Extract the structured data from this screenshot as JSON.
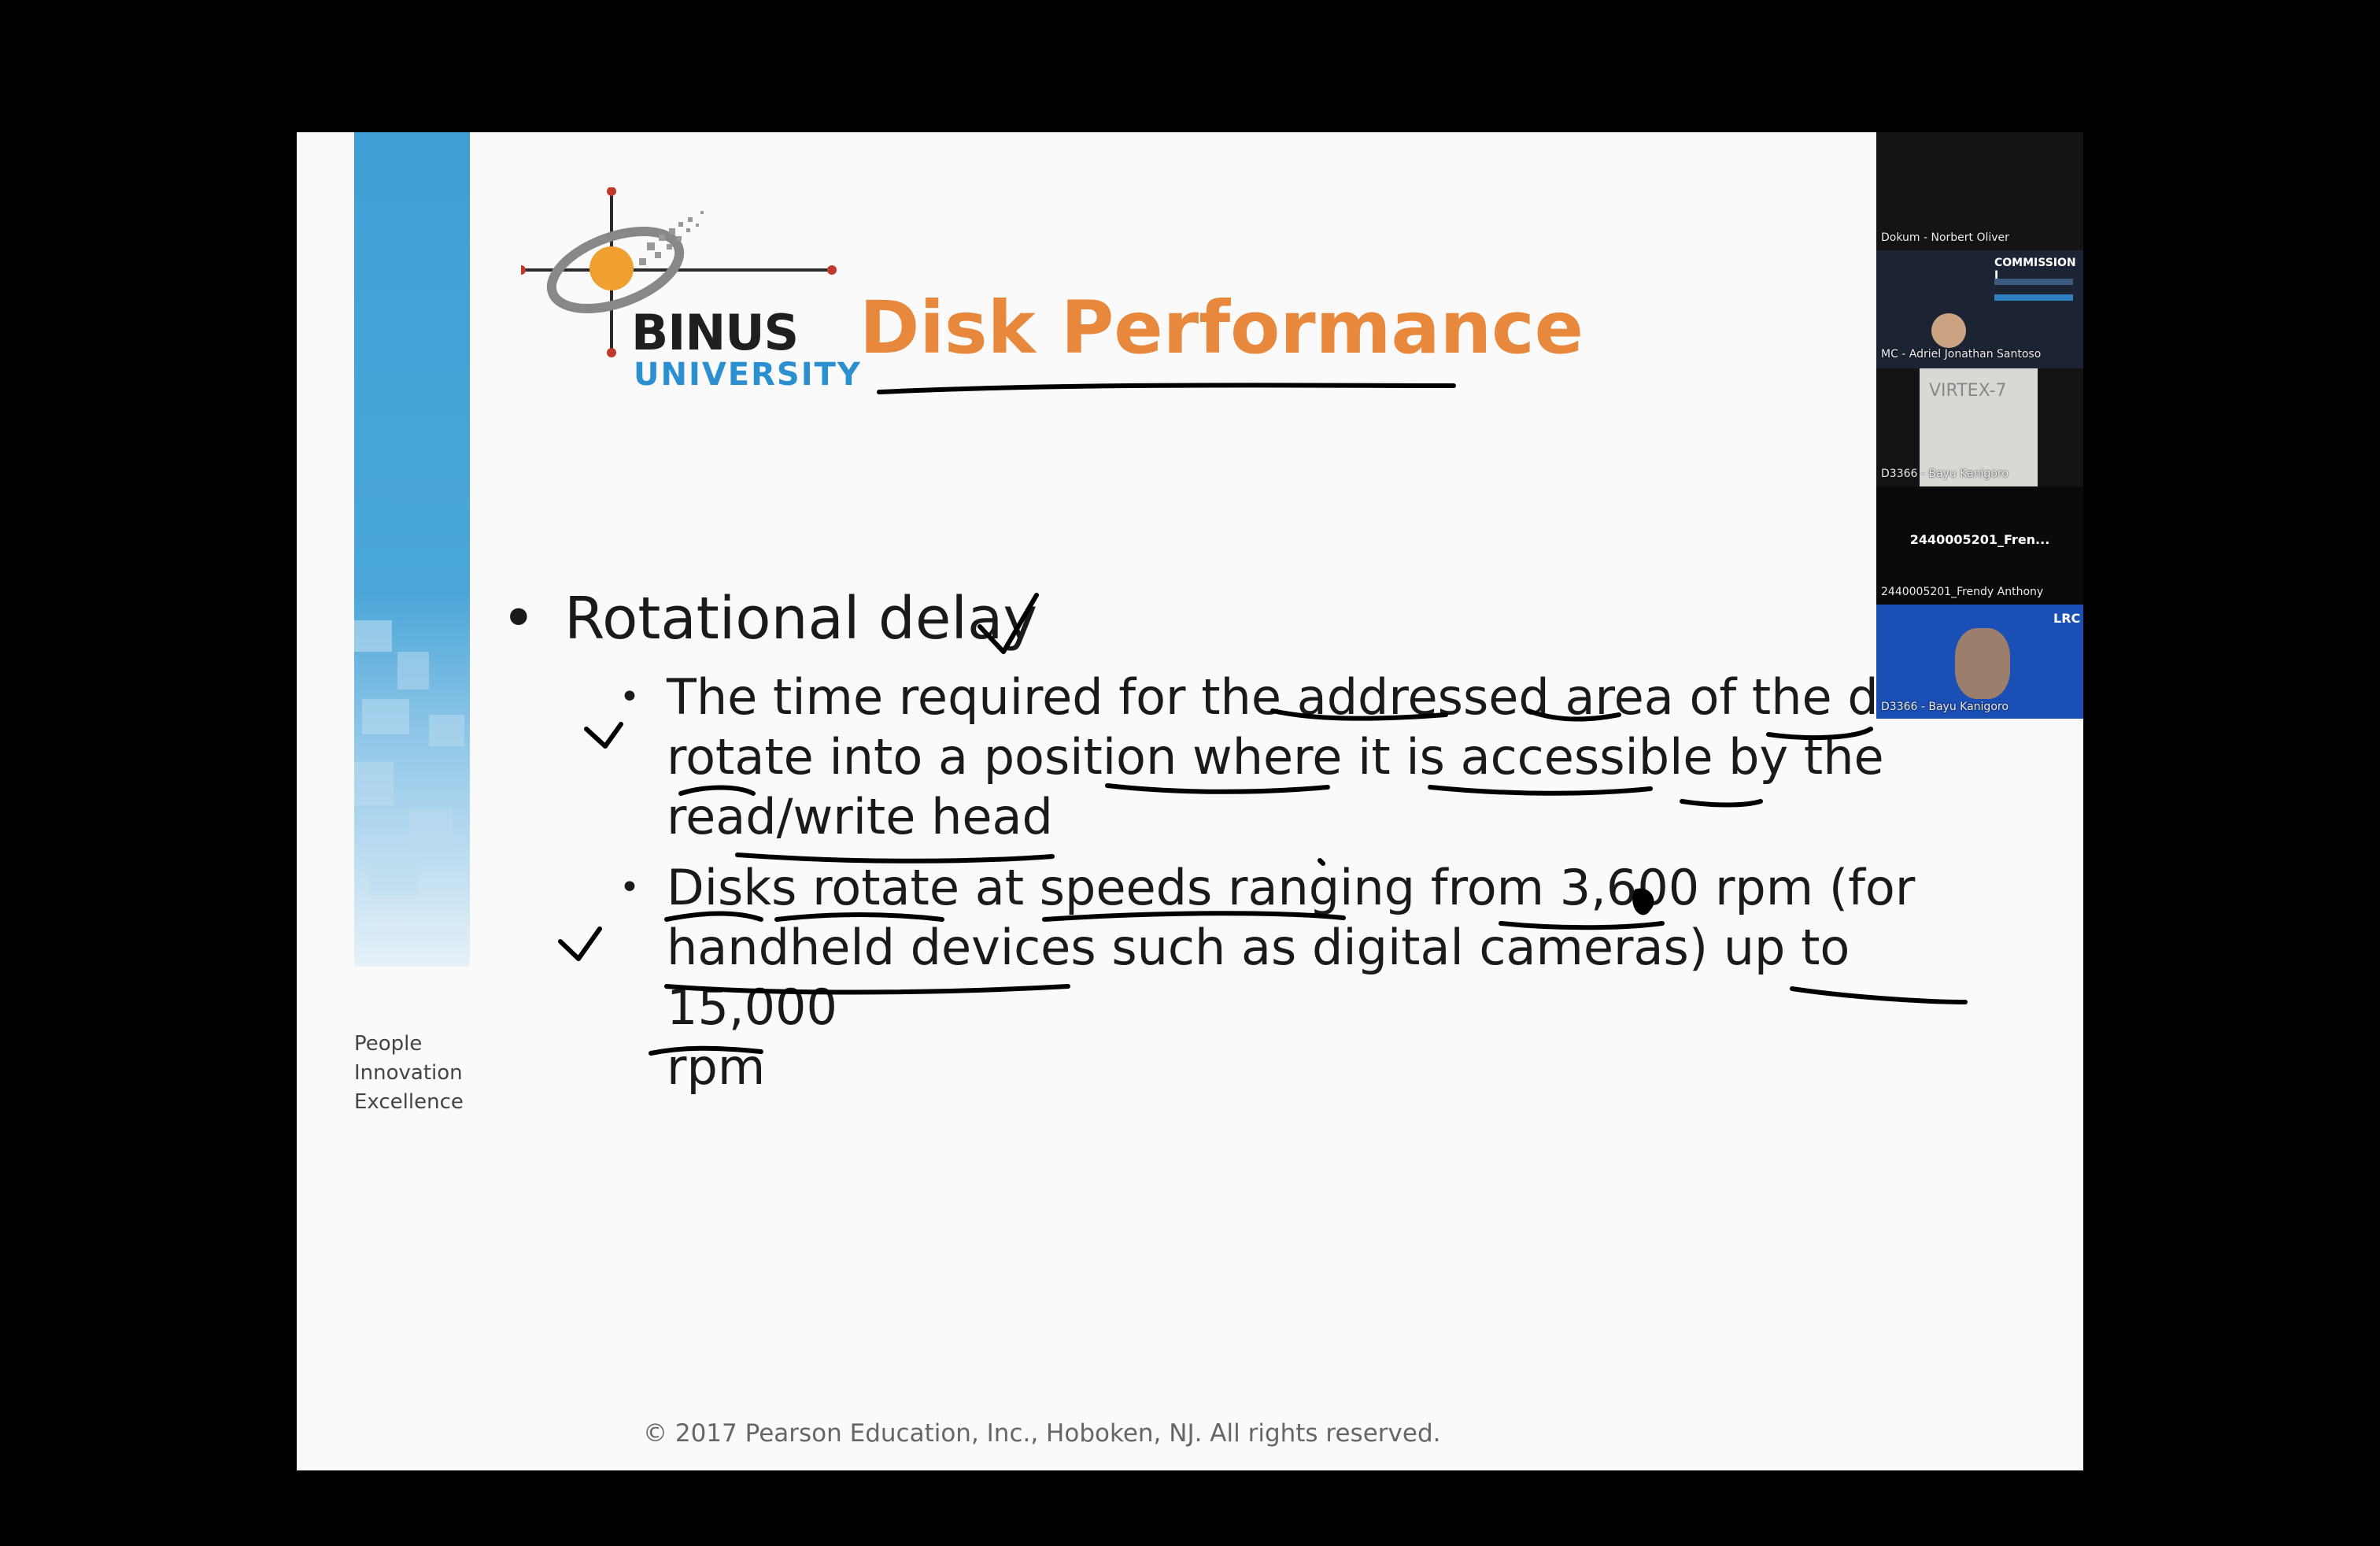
{
  "slide": {
    "logo": {
      "name": "BINUS",
      "subname": "UNIVERSITY"
    },
    "title": "Disk Performance",
    "tagline": [
      "People",
      "Innovation",
      "Excellence"
    ],
    "bullet": "Rotational delay",
    "subbullets": [
      {
        "lines": [
          "The time required for the addressed area of the disk",
          "rotate into a position where it is accessible by the",
          "read/write head"
        ]
      },
      {
        "lines": [
          "Disks rotate at speeds ranging from 3,600 rpm (for",
          "handheld devices such as digital cameras) up to 15,000",
          "rpm"
        ]
      }
    ],
    "bullet_glyph": "•",
    "copyright": "© 2017 Pearson Education, Inc., Hoboken, NJ. All rights reserved.",
    "accent_color": "#e8883c",
    "band_color": "#3f9fd4"
  },
  "video_strip": {
    "tiles": [
      {
        "label": "Dokum - Norbert Oliver",
        "content": ""
      },
      {
        "label": "MC - Adriel Jonathan Santoso",
        "content": "COMMISSION I"
      },
      {
        "label": "D3366 - Bayu Kanigoro",
        "content": "VIRTEX-7"
      },
      {
        "label": "2440005201_Frendy Anthony",
        "content": "2440005201_Fren..."
      },
      {
        "label": "D3366 - Bayu Kanigoro",
        "content": "LRC"
      }
    ]
  }
}
